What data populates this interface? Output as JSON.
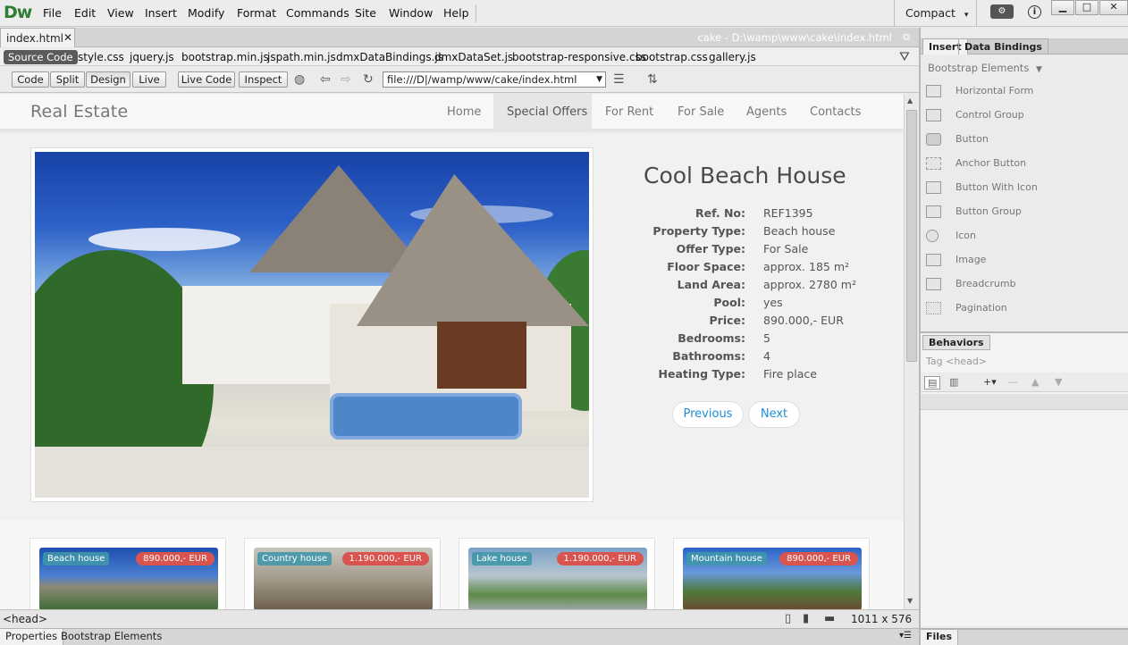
{
  "app": {
    "logo": "Dw",
    "menu": [
      "File",
      "Edit",
      "View",
      "Insert",
      "Modify",
      "Format",
      "Commands",
      "Site",
      "Window",
      "Help"
    ],
    "workspace": "Compact",
    "workspace_arrow": "▾",
    "window_controls": {
      "minimize": "▁",
      "maximize": "□",
      "close": "✕"
    }
  },
  "document": {
    "tab_label": "index.html",
    "tab_close": "✕",
    "path": "cake - D:\\wamp\\www\\cake\\index.html",
    "source_code": "Source Code",
    "related_files": [
      "style.css",
      "jquery.js",
      "bootstrap.min.js",
      "jspath.min.js",
      "dmxDataBindings.js",
      "dmxDataSet.js",
      "bootstrap-responsive.css",
      "bootstrap.css",
      "gallery.js"
    ]
  },
  "toolbar": {
    "code": "Code",
    "split": "Split",
    "design": "Design",
    "live": "Live",
    "live_code": "Live Code",
    "inspect": "Inspect",
    "address": "file:///D|/wamp/www/cake/index.html"
  },
  "site": {
    "brand": "Real Estate",
    "nav": [
      "Home",
      "Special Offers",
      "For Rent",
      "For Sale",
      "Agents",
      "Contacts"
    ],
    "active_nav": "Special Offers",
    "property": {
      "title": "Cool Beach House",
      "details": [
        {
          "label": "Ref. No:",
          "value": "REF1395"
        },
        {
          "label": "Property Type:",
          "value": "Beach house"
        },
        {
          "label": "Offer Type:",
          "value": "For Sale"
        },
        {
          "label": "Floor Space:",
          "value": "approx. 185 m²"
        },
        {
          "label": "Land Area:",
          "value": "approx. 2780 m²"
        },
        {
          "label": "Pool:",
          "value": "yes"
        },
        {
          "label": "Price:",
          "value": "890.000,- EUR"
        },
        {
          "label": "Bedrooms:",
          "value": "5"
        },
        {
          "label": "Bathrooms:",
          "value": "4"
        },
        {
          "label": "Heating Type:",
          "value": "Fire place"
        }
      ],
      "previous": "Previous",
      "next": "Next"
    },
    "cards": [
      {
        "type": "Beach house",
        "price": "890.000,- EUR"
      },
      {
        "type": "Country house",
        "price": "1.190.000,- EUR"
      },
      {
        "type": "Lake house",
        "price": "1.190.000,- EUR"
      },
      {
        "type": "Mountain house",
        "price": "890.000,- EUR"
      }
    ]
  },
  "status": {
    "tag": "<head>",
    "window_size": "1011 x 576"
  },
  "bottom_tabs": {
    "properties": "Properties",
    "bootstrap_elements": "Bootstrap Elements"
  },
  "insert_panel": {
    "tab_insert": "Insert",
    "tab_databindings": "Data Bindings",
    "category": "Bootstrap Elements",
    "items": [
      "Horizontal Form",
      "Control Group",
      "Button",
      "Anchor Button",
      "Button With Icon",
      "Button Group",
      "Icon",
      "Image",
      "Breadcrumb",
      "Pagination"
    ]
  },
  "behaviors_panel": {
    "tab": "Behaviors",
    "tag": "Tag <head>"
  },
  "files_panel": {
    "tab": "Files"
  },
  "colors": {
    "dw_green": "#2e7d32",
    "link_blue": "#1f8dd6",
    "price_red": "#d9534f",
    "badge_teal": "#4096aa"
  }
}
